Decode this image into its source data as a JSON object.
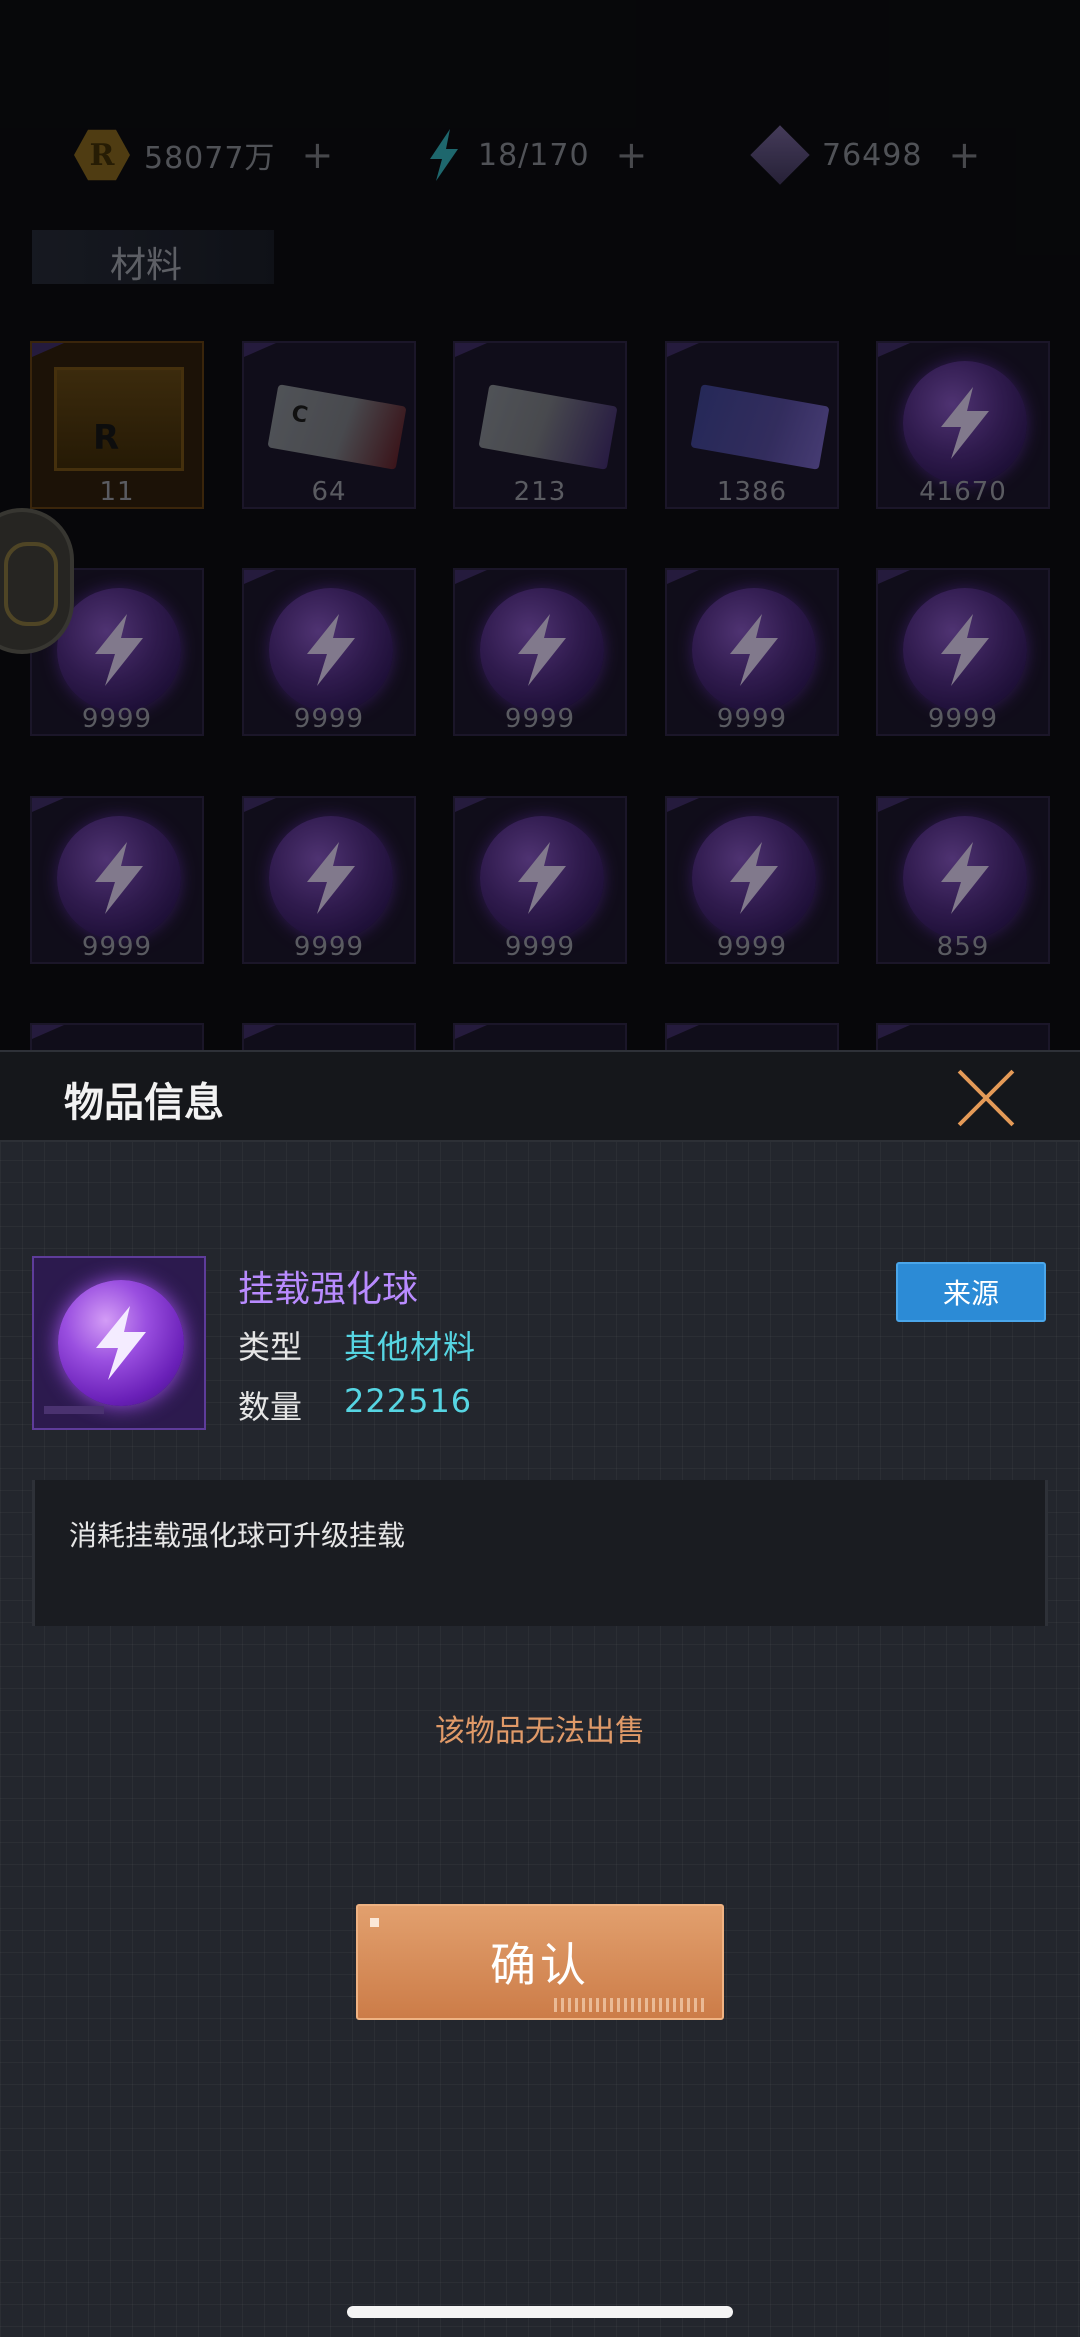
{
  "currencies": [
    {
      "icon": "gold-coin-icon",
      "value": "58077万",
      "plus": "+"
    },
    {
      "icon": "energy-bolt-icon",
      "value": "18/170",
      "plus": "+"
    },
    {
      "icon": "crystal-icon",
      "value": "76498",
      "plus": "+"
    }
  ],
  "section": {
    "title": "材料"
  },
  "inventory": [
    {
      "kind": "box",
      "label": "R",
      "count": "11"
    },
    {
      "kind": "ticket-red",
      "label": "C",
      "count": "64"
    },
    {
      "kind": "ticket-purple",
      "label": "",
      "count": "213"
    },
    {
      "kind": "card",
      "label": "",
      "count": "1386"
    },
    {
      "kind": "orb",
      "label": "",
      "count": "41670"
    },
    {
      "kind": "orb",
      "label": "",
      "count": "9999"
    },
    {
      "kind": "orb",
      "label": "",
      "count": "9999"
    },
    {
      "kind": "orb",
      "label": "",
      "count": "9999"
    },
    {
      "kind": "orb",
      "label": "",
      "count": "9999"
    },
    {
      "kind": "orb",
      "label": "",
      "count": "9999"
    },
    {
      "kind": "orb",
      "label": "",
      "count": "9999"
    },
    {
      "kind": "orb",
      "label": "",
      "count": "9999"
    },
    {
      "kind": "orb",
      "label": "",
      "count": "9999"
    },
    {
      "kind": "orb",
      "label": "",
      "count": "9999"
    },
    {
      "kind": "orb",
      "label": "",
      "count": "859"
    }
  ],
  "panel": {
    "title": "物品信息",
    "item_name": "挂载强化球",
    "type_label": "类型",
    "type_value": "其他材料",
    "count_label": "数量",
    "count_value": "222516",
    "source_button": "来源",
    "description": "消耗挂载强化球可升级挂载",
    "no_sell_notice": "该物品无法出售",
    "confirm_button": "确认"
  },
  "colors": {
    "accent_orange": "#e09a68",
    "item_purple": "#b98bff",
    "value_cyan": "#56d5e2",
    "source_blue": "#2c8bd6"
  }
}
